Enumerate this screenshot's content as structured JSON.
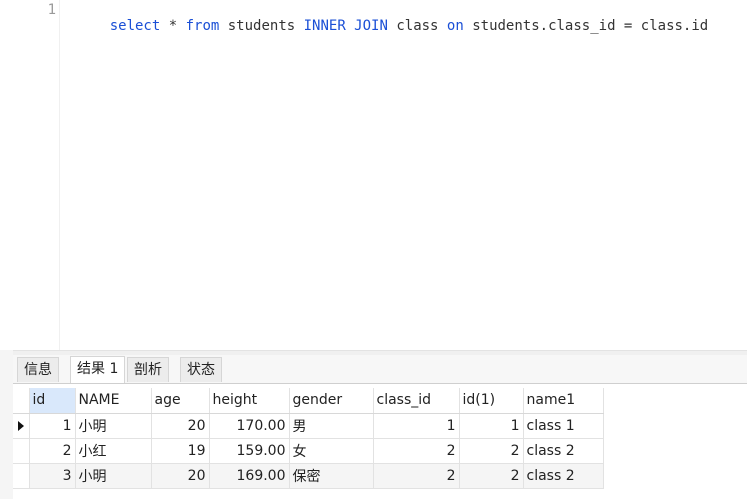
{
  "editor": {
    "line_number": "1",
    "query_tokens": [
      {
        "text": "select",
        "type": "kw"
      },
      {
        "text": " * ",
        "type": "plain"
      },
      {
        "text": "from",
        "type": "kw"
      },
      {
        "text": " students ",
        "type": "plain"
      },
      {
        "text": "INNER JOIN",
        "type": "kw"
      },
      {
        "text": " class ",
        "type": "plain"
      },
      {
        "text": "on",
        "type": "kw"
      },
      {
        "text": " students.class_id = class.id",
        "type": "plain"
      }
    ]
  },
  "tabs": [
    {
      "label": "信息",
      "active": false
    },
    {
      "label": "结果 1",
      "active": true
    },
    {
      "label": "剖析",
      "active": false
    },
    {
      "label": "状态",
      "active": false
    }
  ],
  "results": {
    "columns": [
      "id",
      "NAME",
      "age",
      "height",
      "gender",
      "class_id",
      "id(1)",
      "name1"
    ],
    "rows": [
      [
        "1",
        "小明",
        "20",
        "170.00",
        "男",
        "1",
        "1",
        "class 1"
      ],
      [
        "2",
        "小红",
        "19",
        "159.00",
        "女",
        "2",
        "2",
        "class 2"
      ],
      [
        "3",
        "小明",
        "20",
        "169.00",
        "保密",
        "2",
        "2",
        "class 2"
      ]
    ],
    "current_row_index": 0
  },
  "colors": {
    "keyword": "#1a4fd6",
    "selected_header": "#d9e8fb",
    "alt_row": "#f5f5f5"
  }
}
